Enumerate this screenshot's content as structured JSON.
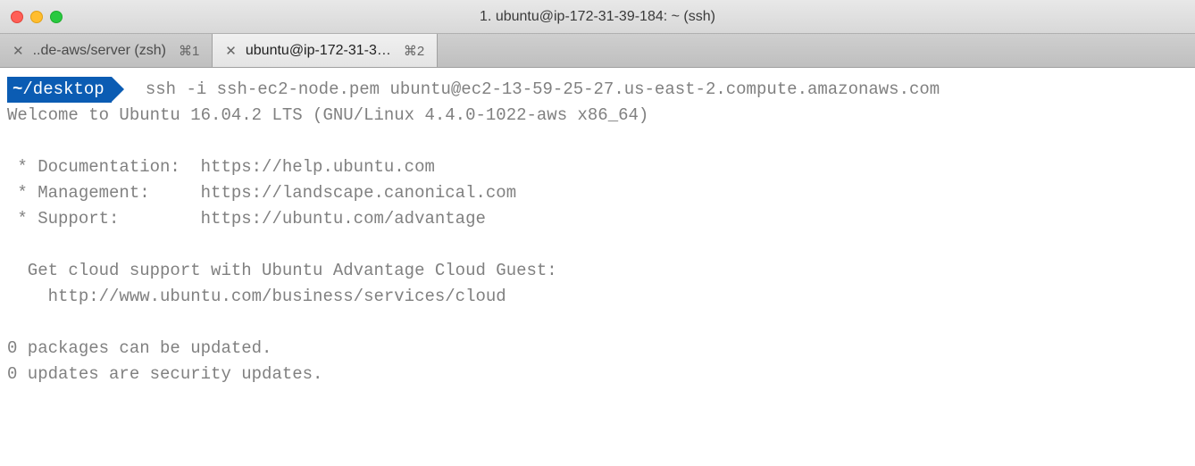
{
  "window": {
    "title": "1. ubuntu@ip-172-31-39-184: ~ (ssh)"
  },
  "tabs": [
    {
      "label": "..de-aws/server (zsh)",
      "shortcut": "⌘1",
      "active": false
    },
    {
      "label": "ubuntu@ip-172-31-3…",
      "shortcut": "⌘2",
      "active": true
    }
  ],
  "prompt": {
    "path_prefix": "~",
    "path": "/desktop"
  },
  "command": "ssh -i ssh-ec2-node.pem ubuntu@ec2-13-59-25-27.us-east-2.compute.amazonaws.com",
  "motd": {
    "welcome": "Welcome to Ubuntu 16.04.2 LTS (GNU/Linux 4.4.0-1022-aws x86_64)",
    "blank1": "",
    "doc": " * Documentation:  https://help.ubuntu.com",
    "mgmt": " * Management:     https://landscape.canonical.com",
    "support": " * Support:        https://ubuntu.com/advantage",
    "blank2": "",
    "cloud1": "  Get cloud support with Ubuntu Advantage Cloud Guest:",
    "cloud2": "    http://www.ubuntu.com/business/services/cloud",
    "blank3": "",
    "pkg": "0 packages can be updated.",
    "sec": "0 updates are security updates."
  }
}
